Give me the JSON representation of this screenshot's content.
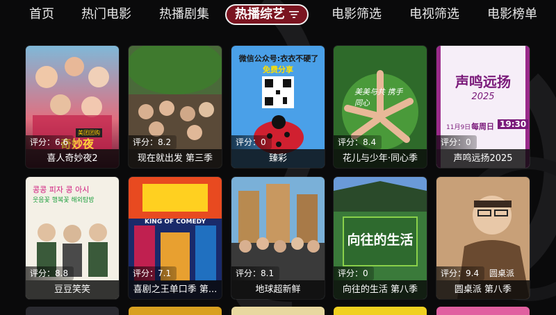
{
  "nav": {
    "items": [
      {
        "label": "首页"
      },
      {
        "label": "热门电影"
      },
      {
        "label": "热播剧集"
      },
      {
        "label": "热播综艺",
        "active": true
      },
      {
        "label": "电影筛选"
      },
      {
        "label": "电视筛选"
      },
      {
        "label": "电影榜单"
      }
    ],
    "active_icon": "filter-icon"
  },
  "cards": [
    {
      "title": "喜人奇妙夜2",
      "score": "评分：6.6",
      "poster_text": "奇妙夜",
      "badge": "美团团购"
    },
    {
      "title": "现在就出发 第三季",
      "score": "评分：8.2"
    },
    {
      "title": "臻彩",
      "score": "评分：0",
      "poster_text_1": "微信公众号:衣衣不硬了",
      "poster_text_2": "免费分享"
    },
    {
      "title": "花儿与少年·同心季",
      "score": "评分：8.4",
      "poster_text": "美美与共 携手同心"
    },
    {
      "title": "声鸣远扬2025",
      "score": "评分：0",
      "poster_text_1": "声鸣远扬",
      "poster_text_2": "2025",
      "poster_text_3": "11月9日",
      "poster_text_4": "每周日",
      "poster_text_5": "19:30"
    },
    {
      "title": "豆豆笑笑",
      "score": "评分：8.8"
    },
    {
      "title": "喜剧之王单口季 第...",
      "score": "评分：7.1",
      "poster_text": "KING OF COMEDY"
    },
    {
      "title": "地球超新鲜",
      "score": "评分：8.1"
    },
    {
      "title": "向往的生活 第八季",
      "score": "评分：0",
      "poster_text": "向往的生活"
    },
    {
      "title": "圆桌派 第八季",
      "score": "评分：9.4",
      "poster_text": "圆桌派"
    }
  ]
}
